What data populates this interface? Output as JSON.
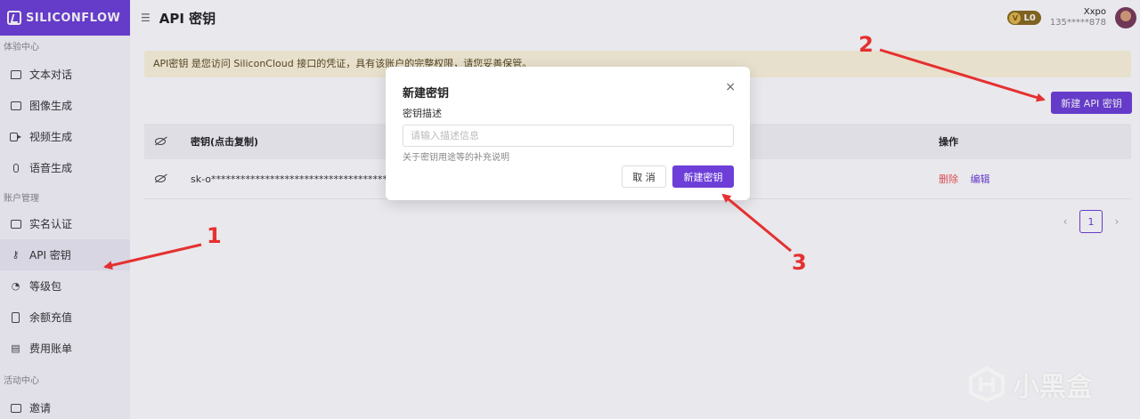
{
  "brand": {
    "name": "SILICONFLOW"
  },
  "sidebar": {
    "sections": [
      {
        "title": "体验中心",
        "items": [
          "文本对话",
          "图像生成",
          "视频生成",
          "语音生成"
        ]
      },
      {
        "title": "账户管理",
        "items": [
          "实名认证",
          "API 密钥",
          "等级包",
          "余额充值",
          "费用账单"
        ]
      },
      {
        "title": "活动中心",
        "items": [
          "邀请"
        ]
      }
    ],
    "active": "API 密钥"
  },
  "header": {
    "menu_icon": "menu-icon",
    "title": "API 密钥",
    "level": "L0",
    "level_mark": "V",
    "user_name": "Xxpo",
    "user_phone": "135*****878"
  },
  "notice": {
    "text": "API密钥 是您访问 SiliconCloud 接口的凭证，具有该账户的完整权限，请您妥善保管。"
  },
  "toolbar": {
    "new_key_label": "新建 API 密钥"
  },
  "table": {
    "columns": {
      "key": "密钥(点击复制)",
      "ops": "操作"
    },
    "rows": [
      {
        "key": "sk-o*************************************************",
        "delete": "删除",
        "edit": "编辑"
      }
    ]
  },
  "pagination": {
    "current": "1",
    "prev": "‹",
    "next": "›"
  },
  "modal": {
    "title": "新建密钥",
    "close": "×",
    "field_label": "密钥描述",
    "placeholder": "请输入描述信息",
    "value": "",
    "help": "关于密钥用途等的补充说明",
    "cancel_label": "取 消",
    "create_label": "新建密钥"
  },
  "annotations": {
    "labels": [
      "1",
      "2",
      "3"
    ],
    "color": "#e53030"
  },
  "watermark": {
    "text": "小黑盒"
  },
  "colors": {
    "accent": "#6d3fd8",
    "notice_bg": "#fdf6dc",
    "danger": "#e55555"
  }
}
